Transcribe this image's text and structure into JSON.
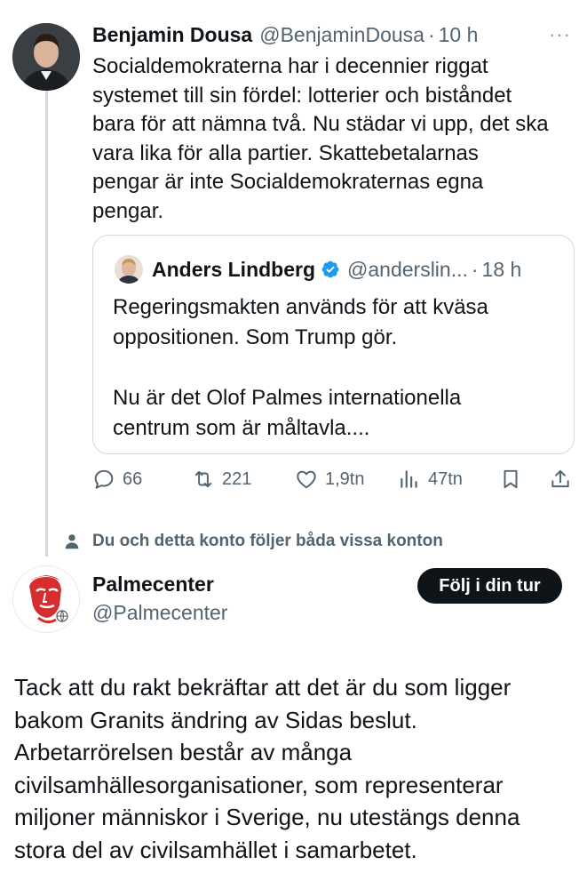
{
  "tweet1": {
    "author_name": "Benjamin Dousa",
    "handle": "@BenjaminDousa",
    "separator": "·",
    "time": "10 h",
    "more": "···",
    "text": "Socialdemokraterna har i decennier riggat\nsystemet till sin fördel: lotterier och biståndet\nbara för att nämna två. Nu städar vi upp, det ska\nvara lika för alla partier. Skattebetalarnas\npengar är inte Socialdemokraternas egna\npengar.",
    "quoted": {
      "author_name": "Anders Lindberg",
      "handle": "@anderslin...",
      "separator": "·",
      "time": "18 h",
      "text": "Regeringsmakten används för att kväsa\noppositionen. Som Trump gör.\n\nNu är det Olof Palmes internationella\ncentrum som är måltavla....",
      "verified_color": "#1d9bf0"
    },
    "actions": {
      "replies": "66",
      "reposts": "221",
      "likes": "1,9tn",
      "views": "47tn"
    }
  },
  "social_context": "Du och detta konto följer båda vissa konton",
  "tweet2": {
    "author_name": "Palmecenter",
    "handle": "@Palmecenter",
    "follow_label": "Följ i din tur",
    "text": "Tack att du rakt bekräftar att det är du som ligger\nbakom Granits ändring av Sidas beslut.\nArbetarrörelsen består av många\ncivilsamhällesorganisationer, som representerar\nmiljoner människor i Sverige, nu utestängs denna\nstora del av civilsamhället i samarbetet.",
    "brand_color": "#d62e2e"
  }
}
